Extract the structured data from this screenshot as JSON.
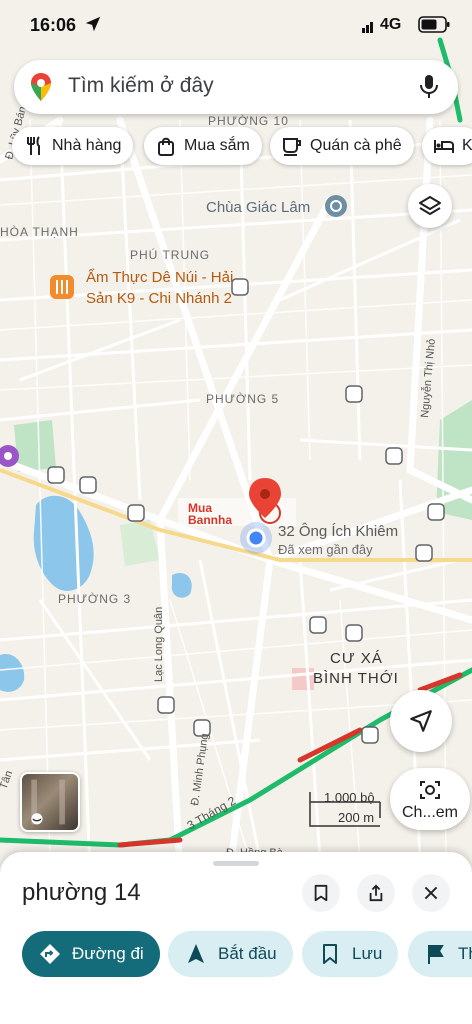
{
  "status_bar": {
    "time": "16:06",
    "network": "4G"
  },
  "search": {
    "placeholder": "Tìm kiếm ở đây"
  },
  "chips": [
    {
      "label": "Nhà hàng",
      "icon": "fork-knife-icon"
    },
    {
      "label": "Mua sắm",
      "icon": "shopping-bag-icon"
    },
    {
      "label": "Quán cà phê",
      "icon": "coffee-cup-icon"
    },
    {
      "label": "Kh",
      "icon": "bed-icon"
    }
  ],
  "map": {
    "area_labels": [
      "PHƯỜNG 10",
      "HÒA THẠNH",
      "PHÚ TRUNG",
      "PHƯỜNG 5",
      "PHƯỜNG 3",
      "CƯ XÁ",
      "BÌNH THỚI"
    ],
    "street_labels": [
      "Đ. Lũy Bán Bích",
      "Lạc Long Quân",
      "Nguyễn Thị Nhỏ",
      "Đ. Minh Phụng",
      "3 Tháng 2",
      "Đ. Hồng Bà",
      "Tân"
    ],
    "poi": {
      "pagoda": "Chùa Giác Lâm",
      "restaurant_line1": "Ẩm Thực Dê Núi - Hải",
      "restaurant_line2": "Sản K9 - Chi Nhánh 2"
    },
    "place_pin": {
      "title": "32 Ông Ích Khiêm",
      "subtitle": "Đã xem gần đây"
    },
    "watermark": {
      "line1": "Mua",
      "line2": "Bannha"
    }
  },
  "scale": {
    "imperial": "1.000 bộ",
    "metric": "200 m"
  },
  "streetview_button": {
    "label": "Ch...em"
  },
  "sheet": {
    "title": "phường 14",
    "actions": [
      {
        "label": "Đường đi",
        "icon": "directions-icon"
      },
      {
        "label": "Bắt đầu",
        "icon": "navigation-arrow-icon"
      },
      {
        "label": "Lưu",
        "icon": "bookmark-icon"
      },
      {
        "label": "Th",
        "icon": "flag-icon"
      }
    ]
  },
  "colors": {
    "road_white": "#ffffff",
    "road_yellow": "#f7d98b",
    "traffic_green": "#1dbb6a",
    "traffic_red": "#d7362b",
    "water": "#8cc6ea",
    "park": "#bfe3c5",
    "pin_red": "#ea4335",
    "location_blue": "#4285f4",
    "primary_button": "#146c7a"
  }
}
